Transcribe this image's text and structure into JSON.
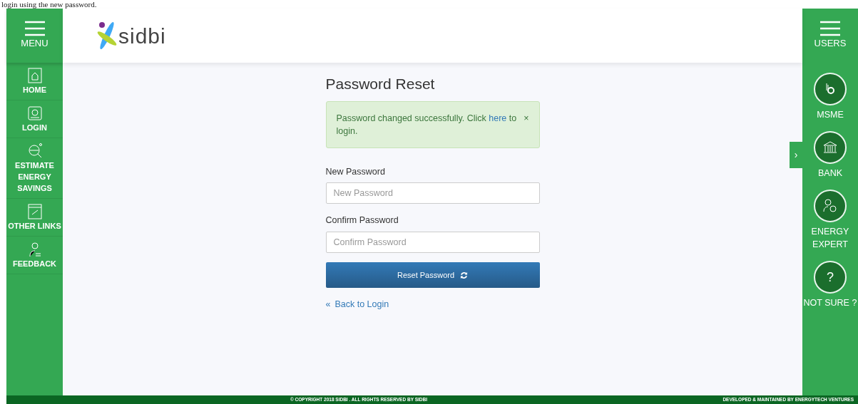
{
  "top_caption": "login using the new password.",
  "left_menu": {
    "label": "MENU"
  },
  "left_nav": [
    {
      "label": "HOME"
    },
    {
      "label": "LOGIN"
    },
    {
      "label": "ESTIMATE ENERGY SAVINGS"
    },
    {
      "label": "OTHER LINKS"
    },
    {
      "label": "FEEDBACK"
    }
  ],
  "logo": {
    "text": "sidbi"
  },
  "form": {
    "title": "Password Reset",
    "alert": {
      "before": "Password changed successfully. Click",
      "link": "here",
      "after": "to login.",
      "close": "×"
    },
    "fields": [
      {
        "label": "New Password",
        "placeholder": "New Password"
      },
      {
        "label": "Confirm Password",
        "placeholder": "Confirm Password"
      }
    ],
    "submit": "Reset Password",
    "back": {
      "icon": "«",
      "label": "Back to Login"
    }
  },
  "side_toggle": "›",
  "right_menu": {
    "label": "USERS"
  },
  "right_nav": [
    {
      "label": "MSME"
    },
    {
      "label": "BANK"
    },
    {
      "label": "ENERGY EXPERT"
    },
    {
      "label": "NOT SURE ?",
      "glyph": "?"
    }
  ],
  "footer": {
    "left": "© COPYRIGHT 2018 SIDBI . ALL RIGHTS RESERVED BY SIDBI",
    "right": "DEVELOPED & MAINTAINED BY ENERGYTECH VENTURES"
  }
}
